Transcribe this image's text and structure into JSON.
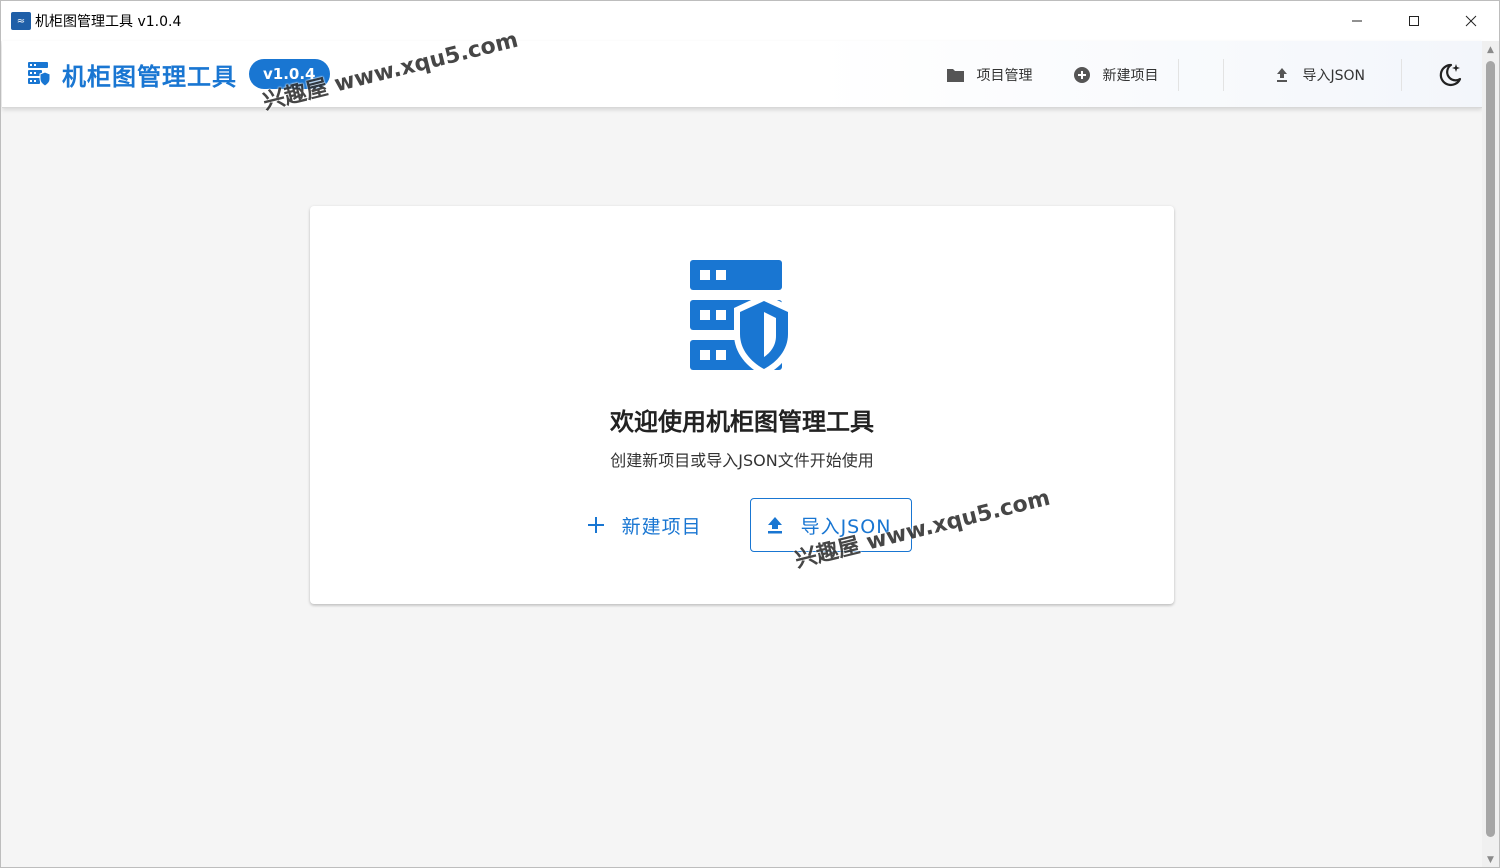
{
  "window": {
    "title": "机柜图管理工具 v1.0.4",
    "minimize_glyph": "—",
    "maximize_glyph": "☐",
    "close_glyph": "✕"
  },
  "header": {
    "brand_title": "机柜图管理工具",
    "version": "v1.0.4",
    "brand_icon": "server-shield-icon",
    "nav": {
      "projects_label": "项目管理",
      "new_project_label": "新建项目",
      "import_json_label": "导入JSON",
      "theme_icon": "moon-star-icon"
    }
  },
  "welcome": {
    "title": "欢迎使用机柜图管理工具",
    "subtitle": "创建新项目或导入JSON文件开始使用",
    "new_project_label": "新建项目",
    "import_json_label": "导入JSON",
    "hero_icon": "server-shield-icon"
  },
  "watermark": {
    "text": "兴趣屋 www.xqu5.com"
  },
  "colors": {
    "accent": "#1976d2",
    "background": "#f5f5f5",
    "card": "#ffffff"
  }
}
